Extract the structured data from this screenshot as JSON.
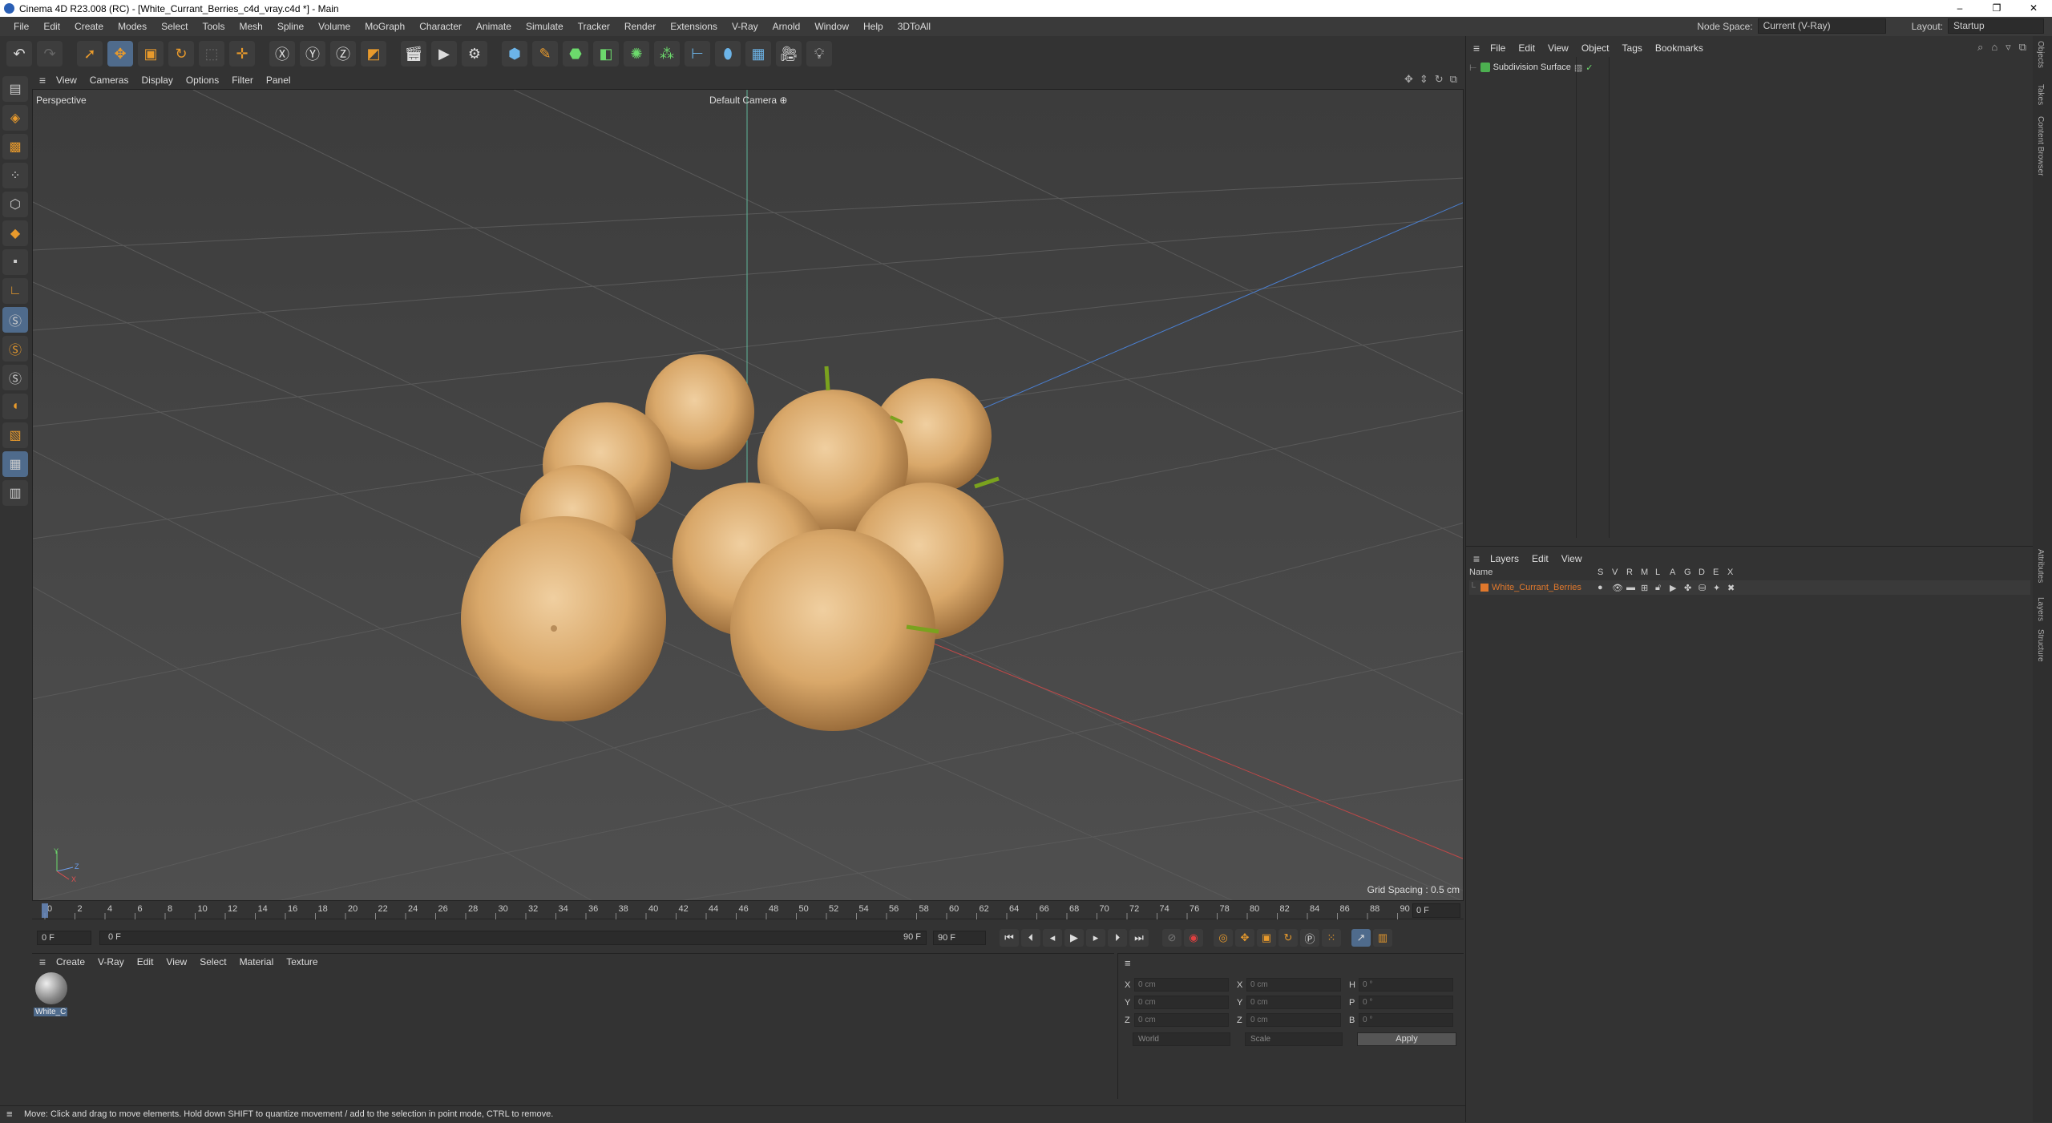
{
  "window": {
    "title": "Cinema 4D R23.008 (RC) - [White_Currant_Berries_c4d_vray.c4d *] - Main",
    "min": "–",
    "max": "❐",
    "close": "✕"
  },
  "menubar": {
    "items": [
      "File",
      "Edit",
      "Create",
      "Modes",
      "Select",
      "Tools",
      "Mesh",
      "Spline",
      "Volume",
      "MoGraph",
      "Character",
      "Animate",
      "Simulate",
      "Tracker",
      "Render",
      "Extensions",
      "V-Ray",
      "Arnold",
      "Window",
      "Help",
      "3DToAll"
    ],
    "node_space_label": "Node Space:",
    "node_space_value": "Current (V-Ray)",
    "layout_label": "Layout:",
    "layout_value": "Startup"
  },
  "viewport": {
    "menu": [
      "View",
      "Cameras",
      "Display",
      "Options",
      "Filter",
      "Panel"
    ],
    "label": "Perspective",
    "camera": "Default Camera",
    "grid_spacing": "Grid Spacing : 0.5 cm",
    "axis_x": "X",
    "axis_y": "Y",
    "axis_z": "Z"
  },
  "timeline": {
    "ticks": [
      "0",
      "2",
      "4",
      "6",
      "8",
      "10",
      "12",
      "14",
      "16",
      "18",
      "20",
      "22",
      "24",
      "26",
      "28",
      "30",
      "32",
      "34",
      "36",
      "38",
      "40",
      "42",
      "44",
      "46",
      "48",
      "50",
      "52",
      "54",
      "56",
      "58",
      "60",
      "62",
      "64",
      "66",
      "68",
      "70",
      "72",
      "74",
      "76",
      "78",
      "80",
      "82",
      "84",
      "86",
      "88",
      "90"
    ],
    "current_frame": "0 F"
  },
  "transport": {
    "start": "0 F",
    "range_start": "0 F",
    "range_end": "90 F",
    "end": "90 F"
  },
  "material_manager": {
    "menu": [
      "Create",
      "V-Ray",
      "Edit",
      "View",
      "Select",
      "Material",
      "Texture"
    ],
    "material_name": "White_C"
  },
  "coordinates": {
    "pos": [
      {
        "axis": "X",
        "value": "0 cm"
      },
      {
        "axis": "Y",
        "value": "0 cm"
      },
      {
        "axis": "Z",
        "value": "0 cm"
      }
    ],
    "size": [
      {
        "axis": "X",
        "value": "0 cm"
      },
      {
        "axis": "Y",
        "value": "0 cm"
      },
      {
        "axis": "Z",
        "value": "0 cm"
      }
    ],
    "rot": [
      {
        "axis": "H",
        "value": "0 °"
      },
      {
        "axis": "P",
        "value": "0 °"
      },
      {
        "axis": "B",
        "value": "0 °"
      }
    ],
    "mode": "World",
    "scale_mode": "Scale",
    "apply": "Apply"
  },
  "status": "Move: Click and drag to move elements. Hold down SHIFT to quantize movement / add to the selection in point mode, CTRL to remove.",
  "object_manager": {
    "menu": [
      "File",
      "Edit",
      "View",
      "Object",
      "Tags",
      "Bookmarks"
    ],
    "object": "Subdivision Surface"
  },
  "layer_manager": {
    "menu": [
      "Layers",
      "Edit",
      "View"
    ],
    "columns": [
      "Name",
      "S",
      "V",
      "R",
      "M",
      "L",
      "A",
      "G",
      "D",
      "E",
      "X"
    ],
    "layer_name": "White_Currant_Berries",
    "layer_color": "#e0782c"
  },
  "side_tabs": [
    "Objects",
    "Takes",
    "Content Browser",
    "Attributes",
    "Layers",
    "Structure"
  ]
}
